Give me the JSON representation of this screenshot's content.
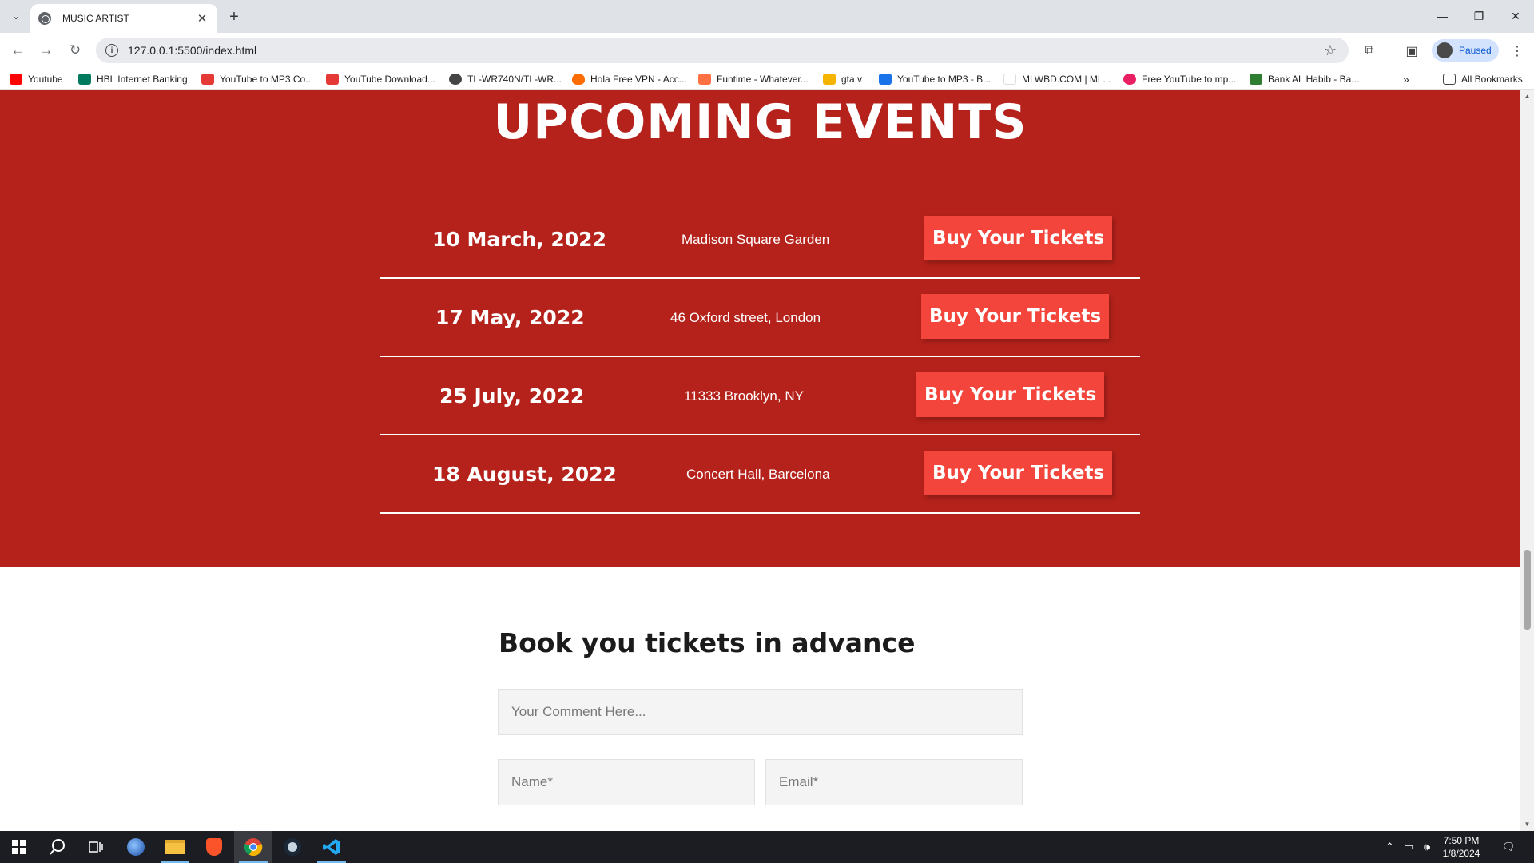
{
  "browser": {
    "tab_title": "MUSIC ARTIST",
    "url": "127.0.0.1:5500/index.html",
    "profile_label": "Paused",
    "bookmarks": [
      {
        "label": "Youtube",
        "color": "#ff0000"
      },
      {
        "label": "HBL Internet Banking",
        "color": "#007a5e"
      },
      {
        "label": "YouTube to MP3 Co...",
        "color": "#e53935"
      },
      {
        "label": "YouTube Download...",
        "color": "#e53935"
      },
      {
        "label": "TL-WR740N/TL-WR...",
        "color": "#444444"
      },
      {
        "label": "Hola Free VPN - Acc...",
        "color": "#ff6d00"
      },
      {
        "label": "Funtime - Whatever...",
        "color": "#ff7043"
      },
      {
        "label": "gta v",
        "color": "#f4b400"
      },
      {
        "label": "YouTube to MP3 - B...",
        "color": "#1a73e8"
      },
      {
        "label": "MLWBD.COM | ML...",
        "color": "#ffffff"
      },
      {
        "label": "Free YouTube to mp...",
        "color": "#e91e63"
      },
      {
        "label": "Bank AL Habib - Ba...",
        "color": "#2e7d32"
      }
    ],
    "all_bookmarks_label": "All Bookmarks"
  },
  "events": {
    "title": "UPCOMING EVENTS",
    "rows": [
      {
        "date": "10 March, 2022",
        "venue": "Madison Square Garden",
        "button": "Buy Your Tickets"
      },
      {
        "date": "17 May, 2022",
        "venue": "46 Oxford street, London",
        "button": "Buy Your Tickets"
      },
      {
        "date": "25 July, 2022",
        "venue": "11333 Brooklyn, NY",
        "button": "Buy Your Tickets"
      },
      {
        "date": "18 August, 2022",
        "venue": "Concert Hall, Barcelona",
        "button": "Buy Your Tickets"
      }
    ]
  },
  "booking": {
    "title": "Book you tickets in advance",
    "comment_placeholder": "Your Comment Here...",
    "name_placeholder": "Name*",
    "email_placeholder": "Email*"
  },
  "taskbar": {
    "time": "7:50 PM",
    "date": "1/8/2024"
  },
  "colors": {
    "events_bg": "#b5221b",
    "button_bg": "#f3453b"
  }
}
